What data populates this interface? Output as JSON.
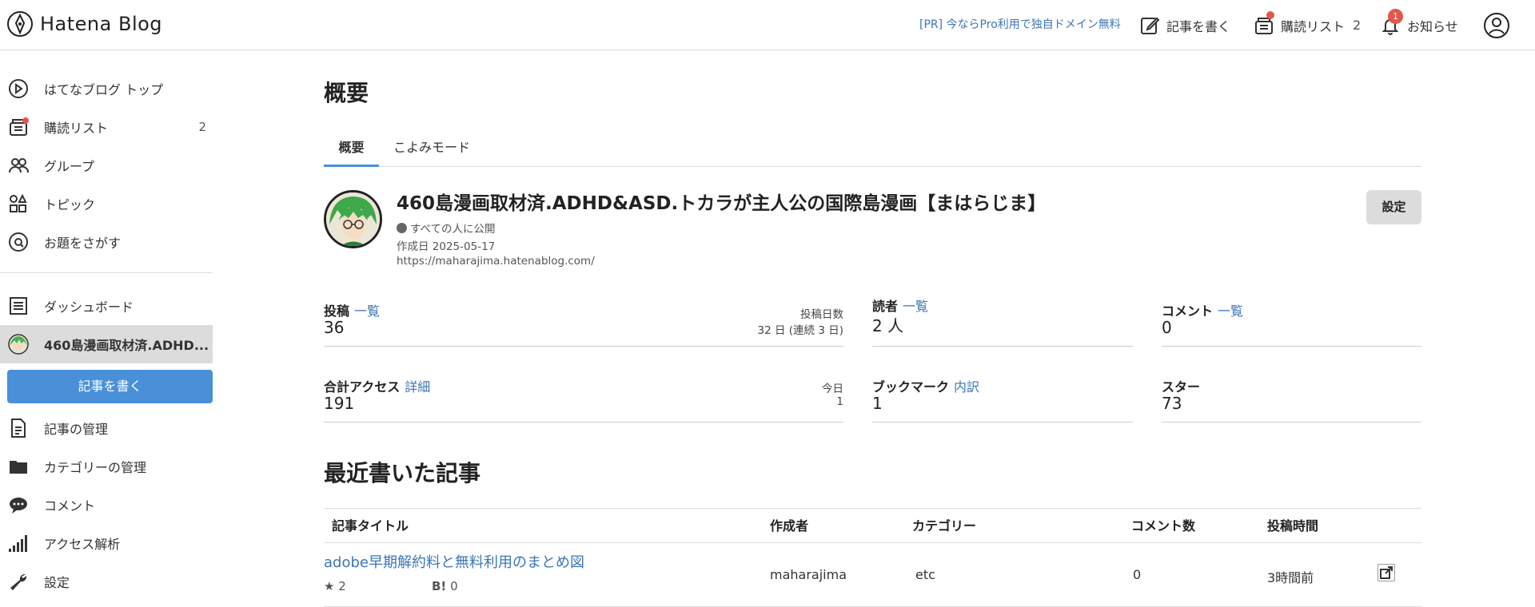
{
  "header": {
    "logo": "Hatena Blog",
    "pr_link": "[PR] 今ならPro利用で独自ドメイン無料",
    "write_label": "記事を書く",
    "reading_list_label": "購読リスト",
    "reading_list_count": "2",
    "notifications_label": "お知らせ",
    "notifications_badge": "1",
    "badge_color": "#e4564b"
  },
  "sidebar": {
    "items": [
      {
        "label": "はてなブログ トップ",
        "icon": "compass-icon"
      },
      {
        "label": "購読リスト",
        "icon": "reading-list-icon",
        "count": "2"
      },
      {
        "label": "グループ",
        "icon": "group-icon"
      },
      {
        "label": "トピック",
        "icon": "topic-icon"
      },
      {
        "label": "お題をさがす",
        "icon": "search-theme-icon"
      }
    ],
    "blog_items": [
      {
        "label": "ダッシュボード",
        "icon": "dashboard-icon"
      },
      {
        "label": "460島漫画取材済.ADHD...",
        "icon": "blog-avatar"
      }
    ],
    "write_button": "記事を書く",
    "manage_items": [
      {
        "label": "記事の管理",
        "icon": "document-icon"
      },
      {
        "label": "カテゴリーの管理",
        "icon": "folder-icon"
      },
      {
        "label": "コメント",
        "icon": "comment-icon"
      },
      {
        "label": "アクセス解析",
        "icon": "signal-icon"
      },
      {
        "label": "設定",
        "icon": "wrench-icon"
      }
    ],
    "accent_color": "#4a90d9"
  },
  "main": {
    "title": "概要",
    "tabs": [
      {
        "label": "概要",
        "active": true
      },
      {
        "label": "こよみモード",
        "active": false
      }
    ],
    "blog": {
      "title": "460島漫画取材済.ADHD&ASD.トカラが主人公の国際島漫画【まはらじま】",
      "visibility": "すべての人に公開",
      "created": "作成日 2025-05-17",
      "url": "https://maharajima.hatenablog.com/",
      "settings_button": "設定"
    },
    "stats": {
      "posts": {
        "label": "投稿",
        "link": "一覧",
        "value": "36",
        "side_label": "投稿日数",
        "side_value": "32 日 (連続 3 日)"
      },
      "readers": {
        "label": "読者",
        "link": "一覧",
        "value": "2 人"
      },
      "comments": {
        "label": "コメント",
        "link": "一覧",
        "value": "0"
      },
      "access": {
        "label": "合計アクセス",
        "link": "詳細",
        "value": "191",
        "side_label": "今日",
        "side_value": "1"
      },
      "bookmarks": {
        "label": "ブックマーク",
        "link": "内訳",
        "value": "1"
      },
      "stars": {
        "label": "スター",
        "value": "73"
      }
    },
    "recent": {
      "title": "最近書いた記事",
      "columns": [
        "記事タイトル",
        "作成者",
        "カテゴリー",
        "コメント数",
        "投稿時間"
      ],
      "rows": [
        {
          "title": "adobe早期解約料と無料利用のまとめ図",
          "stars": "2",
          "bookmark_label": "B!",
          "bookmarks": "0",
          "author": "maharajima",
          "category": "etc",
          "comments": "0",
          "time": "3時間前"
        }
      ]
    }
  }
}
